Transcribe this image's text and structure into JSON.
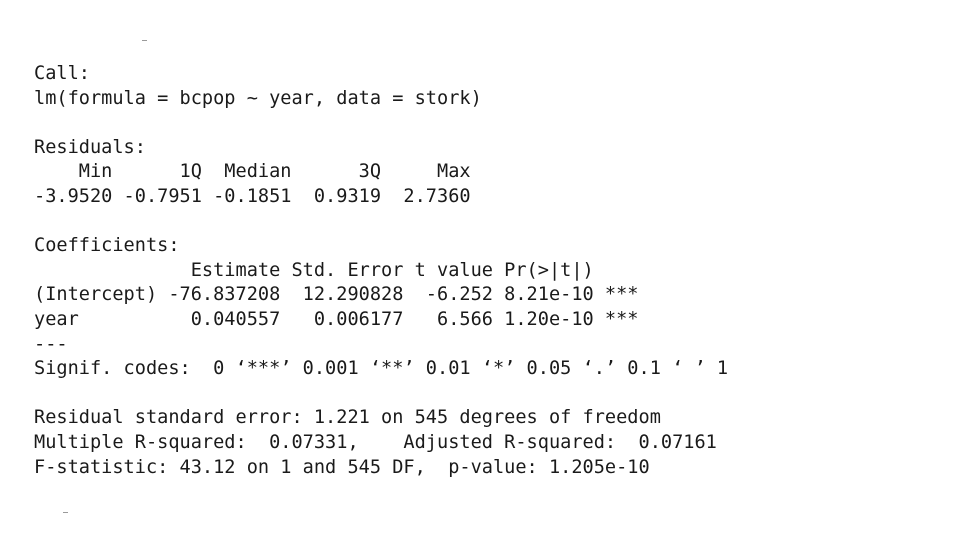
{
  "call_label": "Call:",
  "call_formula": "lm(formula = bcpop ~ year, data = stork)",
  "residuals": {
    "label": "Residuals:",
    "header": "    Min      1Q  Median      3Q     Max",
    "values": "-3.9520 -0.7951 -0.1851  0.9319  2.7360"
  },
  "coefficients": {
    "label": "Coefficients:",
    "header": "              Estimate Std. Error t value Pr(>|t|)",
    "intercept_row": "(Intercept) -76.837208  12.290828  -6.252 8.21e-10 ***",
    "year_row": "year          0.040557   0.006177   6.566 1.20e-10 ***"
  },
  "separator": "---",
  "signif_codes": "Signif. codes:  0 ‘***’ 0.001 ‘**’ 0.01 ‘*’ 0.05 ‘.’ 0.1 ‘ ’ 1",
  "summary": {
    "residual_se": "Residual standard error: 1.221 on 545 degrees of freedom",
    "r_squared": "Multiple R-squared:  0.07331,    Adjusted R-squared:  0.07161",
    "f_statistic": "F-statistic: 43.12 on 1 and 545 DF,  p-value: 1.205e-10"
  }
}
